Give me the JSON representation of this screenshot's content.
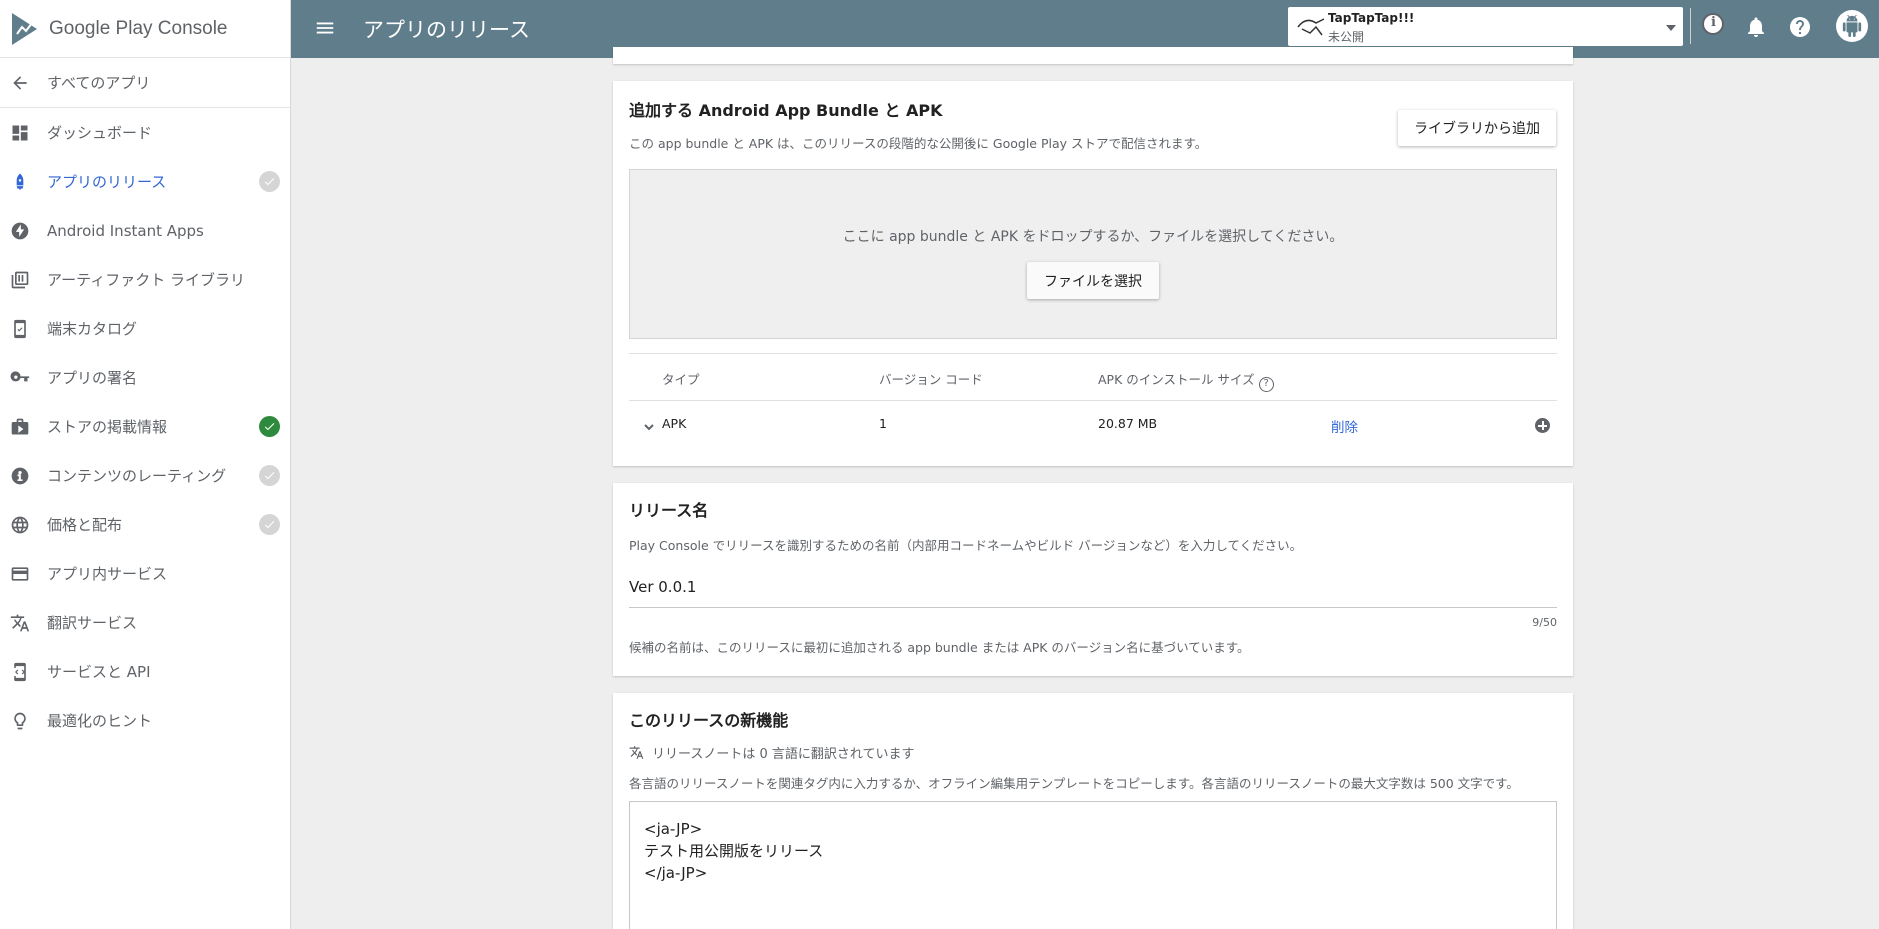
{
  "brand": {
    "name": "Google Play Console"
  },
  "sidebar": {
    "back_label": "すべてのアプリ",
    "items": [
      {
        "label": "ダッシュボード",
        "icon": "dashboard-icon",
        "status": ""
      },
      {
        "label": "アプリのリリース",
        "icon": "rocket-icon",
        "status": "pending",
        "active": true
      },
      {
        "label": "Android Instant Apps",
        "icon": "bolt-icon",
        "status": ""
      },
      {
        "label": "アーティファクト ライブラリ",
        "icon": "library-icon",
        "status": ""
      },
      {
        "label": "端末カタログ",
        "icon": "device-icon",
        "status": ""
      },
      {
        "label": "アプリの署名",
        "icon": "key-icon",
        "status": ""
      },
      {
        "label": "ストアの掲載情報",
        "icon": "store-icon",
        "status": "done"
      },
      {
        "label": "コンテンツのレーティング",
        "icon": "rating-icon",
        "status": "pending"
      },
      {
        "label": "価格と配布",
        "icon": "globe-icon",
        "status": "pending"
      },
      {
        "label": "アプリ内サービス",
        "icon": "card-icon",
        "status": ""
      },
      {
        "label": "翻訳サービス",
        "icon": "translate-icon",
        "status": ""
      },
      {
        "label": "サービスと API",
        "icon": "api-icon",
        "status": ""
      },
      {
        "label": "最適化のヒント",
        "icon": "lightbulb-icon",
        "status": ""
      }
    ]
  },
  "topbar": {
    "title": "アプリのリリース",
    "app_name": "TapTapTap!!!",
    "app_status": "未公開"
  },
  "bundle_card": {
    "title": "追加する Android App Bundle と APK",
    "description": "この app bundle と APK は、このリリースの段階的な公開後に Google Play ストアで配信されます。",
    "add_from_library": "ライブラリから追加",
    "drop_text": "ここに app bundle と APK をドロップするか、ファイルを選択してください。",
    "choose_file": "ファイルを選択",
    "table": {
      "headers": [
        "タイプ",
        "バージョン コード",
        "APK のインストール サイズ"
      ],
      "rows": [
        {
          "type": "APK",
          "version_code": "1",
          "size": "20.87 MB",
          "action": "削除"
        }
      ]
    }
  },
  "release_name_card": {
    "title": "リリース名",
    "description": "Play Console でリリースを識別するための名前（内部用コードネームやビルド バージョンなど）を入力してください。",
    "value": "Ver 0.0.1",
    "counter": "9/50",
    "hint": "候補の名前は、このリリースに最初に追加される app bundle または APK のバージョン名に基づいています。"
  },
  "whats_new_card": {
    "title": "このリリースの新機能",
    "translation_status": "リリースノートは 0 言語に翻訳されています",
    "description": "各言語のリリースノートを関連タグ内に入力するか、オフライン編集用テンプレートをコピーします。各言語のリリースノートの最大文字数は 500 文字です。",
    "notes_value": "<ja-JP>\nテスト用公開版をリリース\n</ja-JP>"
  },
  "colors": {
    "topbar": "#607d8b",
    "accent": "#3367d6",
    "done": "#2e8b3d",
    "pending": "#d5d5d5"
  }
}
